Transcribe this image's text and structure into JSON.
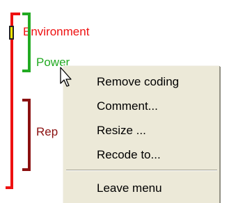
{
  "codes": {
    "environment": {
      "label": "Environment",
      "color": "#ee1111"
    },
    "power": {
      "label": "Power",
      "color": "#22aa22"
    },
    "rep": {
      "label": "Rep",
      "color": "#8b1111"
    }
  },
  "context_menu": {
    "items": [
      {
        "label": "Remove coding"
      },
      {
        "label": "Comment..."
      },
      {
        "label": "Resize ..."
      },
      {
        "label": "Recode to..."
      },
      {
        "label": "Leave menu"
      }
    ]
  },
  "colors": {
    "menu_background": "#ece9d8",
    "handle": "#ffe700"
  }
}
